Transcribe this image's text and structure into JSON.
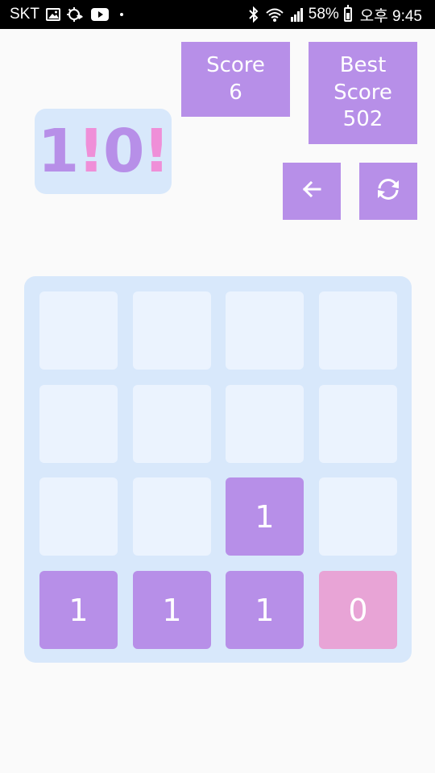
{
  "status_bar": {
    "carrier": "SKT",
    "battery": "58%",
    "time": "오후 9:45",
    "icons": [
      "image-icon",
      "cloud-sync-icon",
      "youtube-icon",
      "bluetooth-icon",
      "wifi-icon",
      "signal-icon",
      "battery-icon"
    ]
  },
  "logo": {
    "one": "1",
    "bang1": "!",
    "zero": "0",
    "bang2": "!"
  },
  "score": {
    "label": "Score",
    "value": "6"
  },
  "best": {
    "label": "Best Score",
    "value": "502"
  },
  "buttons": {
    "undo_icon": "arrow-left-icon",
    "restart_icon": "refresh-icon"
  },
  "board": {
    "rows": [
      [
        "",
        "",
        "",
        ""
      ],
      [
        "",
        "",
        "",
        ""
      ],
      [
        "",
        "",
        "1",
        ""
      ],
      [
        "1",
        "1",
        "1",
        "0"
      ]
    ]
  },
  "colors": {
    "tile_one": "#b78fe8",
    "tile_zero": "#e8a4d6",
    "empty_cell": "#ebf3fe",
    "board_bg": "#d8e8fb",
    "accent": "#b78fe8"
  }
}
